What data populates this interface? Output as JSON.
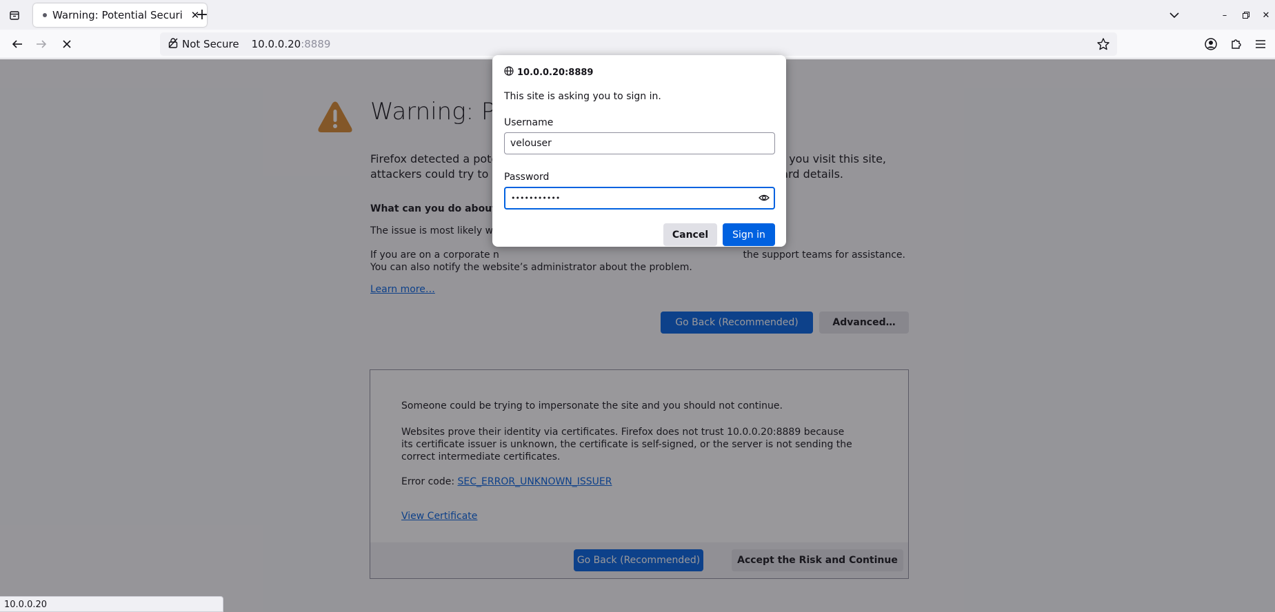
{
  "browser": {
    "tab": {
      "title": "Warning: Potential Securi",
      "favicon": "dot-icon"
    },
    "urlbar": {
      "identity_label": "Not Secure",
      "host": "10.0.0.20",
      "port": ":8889"
    }
  },
  "page": {
    "title": "Warning: Po",
    "intro": "Firefox detected a pote                                                                                f you visit this site, attackers could try to st                                                                           ard details.",
    "intro_line1": "Firefox detected a pote",
    "intro_line1_end": "f you visit this site,",
    "intro_line2": "attackers could try to st",
    "intro_line2_end": "ard details.",
    "what_heading": "What can you do about it?",
    "issue_text": "The issue is most likely with",
    "corporate_line1": "If you are on a corporate n",
    "corporate_line1_end": "the support teams for assistance.",
    "corporate_line2": "You can also notify the website’s administrator about the problem.",
    "learn_more": "Learn more…",
    "go_back": "Go Back (Recommended)",
    "advanced": "Advanced…",
    "advanced_panel": {
      "impersonate": "Someone could be trying to impersonate the site and you should not continue.",
      "certs": "Websites prove their identity via certificates. Firefox does not trust 10.0.0.20:8889 because its certificate issuer is unknown, the certificate is self-signed, or the server is not sending the correct intermediate certificates.",
      "error_code_label": "Error code: ",
      "error_code": "SEC_ERROR_UNKNOWN_ISSUER",
      "view_certificate": "View Certificate",
      "go_back": "Go Back (Recommended)",
      "accept": "Accept the Risk and Continue"
    }
  },
  "auth_dialog": {
    "origin": "10.0.0.20:8889",
    "message": "This site is asking you to sign in.",
    "username_label": "Username",
    "username_value": "velouser",
    "password_label": "Password",
    "password_value": "•••••••••••",
    "cancel": "Cancel",
    "sign_in": "Sign in"
  },
  "status": "10.0.0.20",
  "colors": {
    "accent": "#0061e0",
    "warning": "#d7892e"
  }
}
